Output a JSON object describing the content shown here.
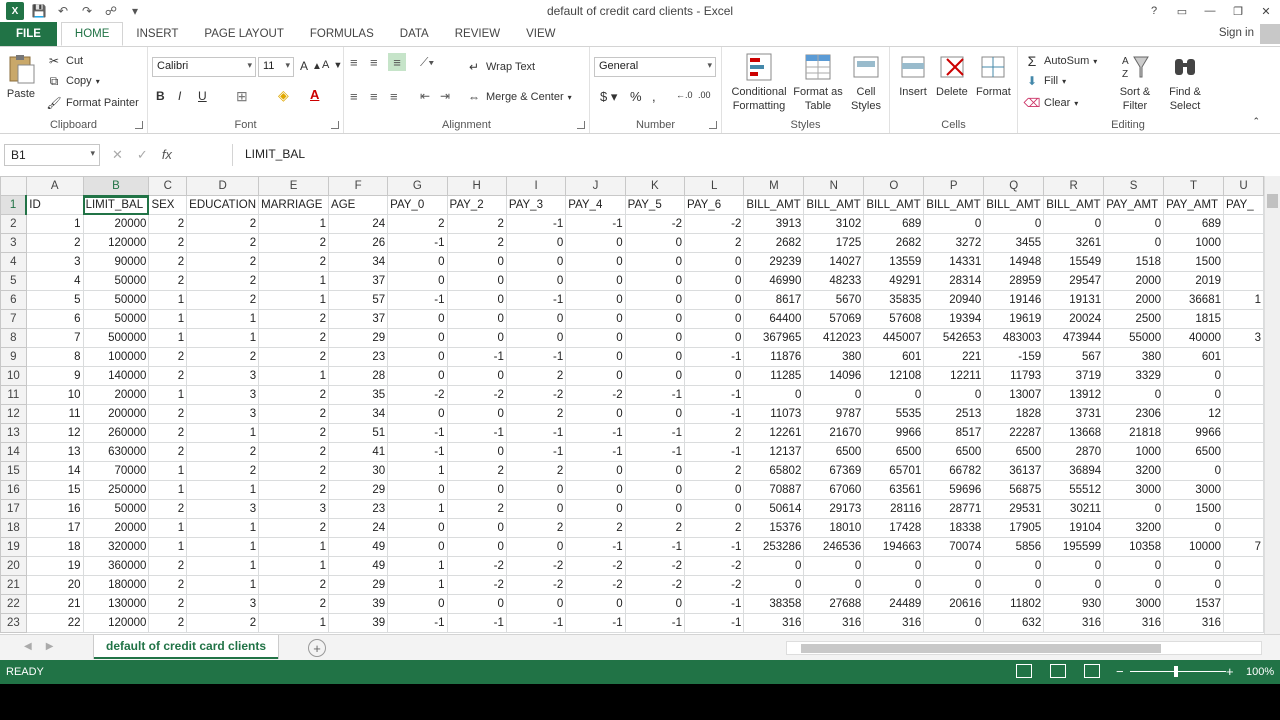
{
  "window": {
    "title": "default of credit card clients - Excel"
  },
  "ribbon_tabs": [
    "FILE",
    "HOME",
    "INSERT",
    "PAGE LAYOUT",
    "FORMULAS",
    "DATA",
    "REVIEW",
    "VIEW"
  ],
  "active_tab": "HOME",
  "signin": "Sign in",
  "clipboard": {
    "paste": "Paste",
    "cut": "Cut",
    "copy": "Copy",
    "format_painter": "Format Painter",
    "label": "Clipboard"
  },
  "font": {
    "name": "Calibri",
    "size": "11",
    "label": "Font"
  },
  "alignment": {
    "wrap": "Wrap Text",
    "merge": "Merge & Center",
    "label": "Alignment"
  },
  "number": {
    "format": "General",
    "label": "Number"
  },
  "styles": {
    "conditional": "Conditional Formatting",
    "format_table": "Format as Table",
    "cell_styles": "Cell Styles",
    "label": "Styles"
  },
  "cells": {
    "insert": "Insert",
    "delete": "Delete",
    "format": "Format",
    "label": "Cells"
  },
  "editing": {
    "autosum": "AutoSum",
    "fill": "Fill",
    "clear": "Clear",
    "sort": "Sort & Filter",
    "find": "Find & Select",
    "label": "Editing"
  },
  "formula_bar": {
    "namebox": "B1",
    "fx": "fx",
    "content": "LIMIT_BAL"
  },
  "sheet": {
    "columns": [
      "A",
      "B",
      "C",
      "D",
      "E",
      "F",
      "G",
      "H",
      "I",
      "J",
      "K",
      "L",
      "M",
      "N",
      "O",
      "P",
      "Q",
      "R",
      "S",
      "T",
      "U"
    ],
    "headers": [
      "ID",
      "LIMIT_BAL",
      "SEX",
      "EDUCATION",
      "MARRIAGE",
      "AGE",
      "PAY_0",
      "PAY_2",
      "PAY_3",
      "PAY_4",
      "PAY_5",
      "PAY_6",
      "BILL_AMT",
      "BILL_AMT",
      "BILL_AMT",
      "BILL_AMT",
      "BILL_AMT",
      "BILL_AMT",
      "PAY_AMT",
      "PAY_AMT",
      "PAY_"
    ],
    "rows": [
      [
        "1",
        "20000",
        "2",
        "2",
        "1",
        "24",
        "2",
        "2",
        "-1",
        "-1",
        "-2",
        "-2",
        "3913",
        "3102",
        "689",
        "0",
        "0",
        "0",
        "0",
        "689",
        ""
      ],
      [
        "2",
        "120000",
        "2",
        "2",
        "2",
        "26",
        "-1",
        "2",
        "0",
        "0",
        "0",
        "2",
        "2682",
        "1725",
        "2682",
        "3272",
        "3455",
        "3261",
        "0",
        "1000",
        ""
      ],
      [
        "3",
        "90000",
        "2",
        "2",
        "2",
        "34",
        "0",
        "0",
        "0",
        "0",
        "0",
        "0",
        "29239",
        "14027",
        "13559",
        "14331",
        "14948",
        "15549",
        "1518",
        "1500",
        ""
      ],
      [
        "4",
        "50000",
        "2",
        "2",
        "1",
        "37",
        "0",
        "0",
        "0",
        "0",
        "0",
        "0",
        "46990",
        "48233",
        "49291",
        "28314",
        "28959",
        "29547",
        "2000",
        "2019",
        ""
      ],
      [
        "5",
        "50000",
        "1",
        "2",
        "1",
        "57",
        "-1",
        "0",
        "-1",
        "0",
        "0",
        "0",
        "8617",
        "5670",
        "35835",
        "20940",
        "19146",
        "19131",
        "2000",
        "36681",
        "1"
      ],
      [
        "6",
        "50000",
        "1",
        "1",
        "2",
        "37",
        "0",
        "0",
        "0",
        "0",
        "0",
        "0",
        "64400",
        "57069",
        "57608",
        "19394",
        "19619",
        "20024",
        "2500",
        "1815",
        ""
      ],
      [
        "7",
        "500000",
        "1",
        "1",
        "2",
        "29",
        "0",
        "0",
        "0",
        "0",
        "0",
        "0",
        "367965",
        "412023",
        "445007",
        "542653",
        "483003",
        "473944",
        "55000",
        "40000",
        "3"
      ],
      [
        "8",
        "100000",
        "2",
        "2",
        "2",
        "23",
        "0",
        "-1",
        "-1",
        "0",
        "0",
        "-1",
        "11876",
        "380",
        "601",
        "221",
        "-159",
        "567",
        "380",
        "601",
        ""
      ],
      [
        "9",
        "140000",
        "2",
        "3",
        "1",
        "28",
        "0",
        "0",
        "2",
        "0",
        "0",
        "0",
        "11285",
        "14096",
        "12108",
        "12211",
        "11793",
        "3719",
        "3329",
        "0",
        ""
      ],
      [
        "10",
        "20000",
        "1",
        "3",
        "2",
        "35",
        "-2",
        "-2",
        "-2",
        "-2",
        "-1",
        "-1",
        "0",
        "0",
        "0",
        "0",
        "13007",
        "13912",
        "0",
        "0",
        ""
      ],
      [
        "11",
        "200000",
        "2",
        "3",
        "2",
        "34",
        "0",
        "0",
        "2",
        "0",
        "0",
        "-1",
        "11073",
        "9787",
        "5535",
        "2513",
        "1828",
        "3731",
        "2306",
        "12",
        ""
      ],
      [
        "12",
        "260000",
        "2",
        "1",
        "2",
        "51",
        "-1",
        "-1",
        "-1",
        "-1",
        "-1",
        "2",
        "12261",
        "21670",
        "9966",
        "8517",
        "22287",
        "13668",
        "21818",
        "9966",
        ""
      ],
      [
        "13",
        "630000",
        "2",
        "2",
        "2",
        "41",
        "-1",
        "0",
        "-1",
        "-1",
        "-1",
        "-1",
        "12137",
        "6500",
        "6500",
        "6500",
        "6500",
        "2870",
        "1000",
        "6500",
        ""
      ],
      [
        "14",
        "70000",
        "1",
        "2",
        "2",
        "30",
        "1",
        "2",
        "2",
        "0",
        "0",
        "2",
        "65802",
        "67369",
        "65701",
        "66782",
        "36137",
        "36894",
        "3200",
        "0",
        ""
      ],
      [
        "15",
        "250000",
        "1",
        "1",
        "2",
        "29",
        "0",
        "0",
        "0",
        "0",
        "0",
        "0",
        "70887",
        "67060",
        "63561",
        "59696",
        "56875",
        "55512",
        "3000",
        "3000",
        ""
      ],
      [
        "16",
        "50000",
        "2",
        "3",
        "3",
        "23",
        "1",
        "2",
        "0",
        "0",
        "0",
        "0",
        "50614",
        "29173",
        "28116",
        "28771",
        "29531",
        "30211",
        "0",
        "1500",
        ""
      ],
      [
        "17",
        "20000",
        "1",
        "1",
        "2",
        "24",
        "0",
        "0",
        "2",
        "2",
        "2",
        "2",
        "15376",
        "18010",
        "17428",
        "18338",
        "17905",
        "19104",
        "3200",
        "0",
        ""
      ],
      [
        "18",
        "320000",
        "1",
        "1",
        "1",
        "49",
        "0",
        "0",
        "0",
        "-1",
        "-1",
        "-1",
        "253286",
        "246536",
        "194663",
        "70074",
        "5856",
        "195599",
        "10358",
        "10000",
        "7"
      ],
      [
        "19",
        "360000",
        "2",
        "1",
        "1",
        "49",
        "1",
        "-2",
        "-2",
        "-2",
        "-2",
        "-2",
        "0",
        "0",
        "0",
        "0",
        "0",
        "0",
        "0",
        "0",
        ""
      ],
      [
        "20",
        "180000",
        "2",
        "1",
        "2",
        "29",
        "1",
        "-2",
        "-2",
        "-2",
        "-2",
        "-2",
        "0",
        "0",
        "0",
        "0",
        "0",
        "0",
        "0",
        "0",
        ""
      ],
      [
        "21",
        "130000",
        "2",
        "3",
        "2",
        "39",
        "0",
        "0",
        "0",
        "0",
        "0",
        "-1",
        "38358",
        "27688",
        "24489",
        "20616",
        "11802",
        "930",
        "3000",
        "1537",
        ""
      ],
      [
        "22",
        "120000",
        "2",
        "2",
        "1",
        "39",
        "-1",
        "-1",
        "-1",
        "-1",
        "-1",
        "-1",
        "316",
        "316",
        "316",
        "0",
        "632",
        "316",
        "316",
        "316",
        ""
      ]
    ],
    "tab_name": "default of credit card clients"
  },
  "status": {
    "ready": "READY",
    "zoom": "100%"
  }
}
